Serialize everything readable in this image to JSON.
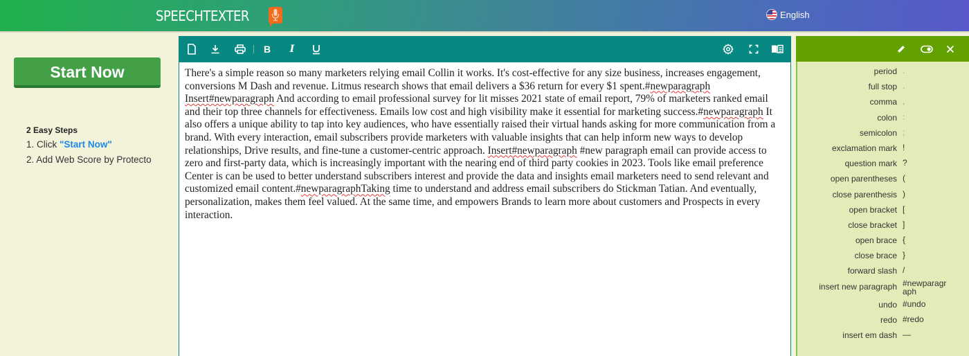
{
  "header": {
    "logo_text": "SPEECHTEXTER",
    "logo_icon": "microphone-icon",
    "language": "English",
    "language_icon": "us-flag-icon",
    "colors": {
      "gradient_start": "#22b14c",
      "gradient_end": "#5858ca",
      "logo_badge": "#f26a1b"
    }
  },
  "left_panel": {
    "start_button": "Start Now",
    "steps_title": "2 Easy Steps",
    "step1_prefix": "1. Click ",
    "step1_highlight": "\"Start Now\"",
    "step2": "2. Add Web Score by Protecto"
  },
  "editor": {
    "toolbar": {
      "left_icons": [
        "new-document-icon",
        "download-icon",
        "print-icon",
        "bold-icon",
        "italic-icon",
        "underline-icon"
      ],
      "right_icons": [
        "settings-icon",
        "fullscreen-icon",
        "reader-icon"
      ],
      "color": "#078883"
    },
    "segments": [
      {
        "t": "There's a simple reason so many marketers relying email Collin it works. It's cost-effective for any size business, increases engagement, conversions M Dash and revenue. Litmus research shows that email delivers a $36 return for every $1 spent.#",
        "s": false
      },
      {
        "t": "newparagraph",
        "s": true
      },
      {
        "t": " ",
        "s": false
      },
      {
        "t": "Insert#newparagraph",
        "s": true
      },
      {
        "t": " And according to email professional survey for lit misses 2021 state of email report, 79% of marketers ranked email and their top three channels for effectiveness. Emails low cost and high visibility make it essential for marketing success.#",
        "s": false
      },
      {
        "t": "newparagraph",
        "s": true
      },
      {
        "t": " It also offers a unique ability to tap into key audiences, who have essentially raised their virtual hands asking for more communication from a brand. With every interaction, email subscribers provide marketers with valuable insights that can help inform new ways to develop relationships, Drive results, and fine-tune a customer-centric approach. ",
        "s": false
      },
      {
        "t": "Insert#newparagraph",
        "s": true
      },
      {
        "t": " #new paragraph email can provide access to zero and first-party data, which is increasingly important with the nearing end of third party cookies in 2023. Tools like email preference Center is can be used to better understand subscribers interest and provide the data and insights email marketers need to send relevant and customized email content.#",
        "s": false
      },
      {
        "t": "newparagraphTaking",
        "s": true
      },
      {
        "t": " time to understand and address email subscribers do Stickman Tatian. And eventually, personalization, makes them feel valued. At the same time, and empowers Brands to learn more about customers and Prospects in every interaction.",
        "s": false
      }
    ]
  },
  "commands_panel": {
    "toolbar_icons": [
      "edit-icon",
      "toggle-icon",
      "close-icon"
    ],
    "color": "#62a100",
    "commands": [
      {
        "name": "period",
        "value": ".",
        "light": true
      },
      {
        "name": "full stop",
        "value": ".",
        "light": true
      },
      {
        "name": "comma",
        "value": ",",
        "light": true
      },
      {
        "name": "colon",
        "value": ":",
        "light": true
      },
      {
        "name": "semicolon",
        "value": ";",
        "light": true
      },
      {
        "name": "exclamation mark",
        "value": "!",
        "light": false
      },
      {
        "name": "question mark",
        "value": "?",
        "light": false
      },
      {
        "name": "open parentheses",
        "value": "(",
        "light": false
      },
      {
        "name": "close parenthesis",
        "value": ")",
        "light": false
      },
      {
        "name": "open bracket",
        "value": "[",
        "light": false
      },
      {
        "name": "close bracket",
        "value": "]",
        "light": false
      },
      {
        "name": "open brace",
        "value": "{",
        "light": false
      },
      {
        "name": "close brace",
        "value": "}",
        "light": false
      },
      {
        "name": "forward slash",
        "value": "/",
        "light": false
      },
      {
        "name": "insert new paragraph",
        "value": "#newparagraph",
        "light": false
      },
      {
        "name": "undo",
        "value": "#undo",
        "light": false
      },
      {
        "name": "redo",
        "value": "#redo",
        "light": false
      },
      {
        "name": "insert em dash",
        "value": "—",
        "light": false
      }
    ]
  }
}
